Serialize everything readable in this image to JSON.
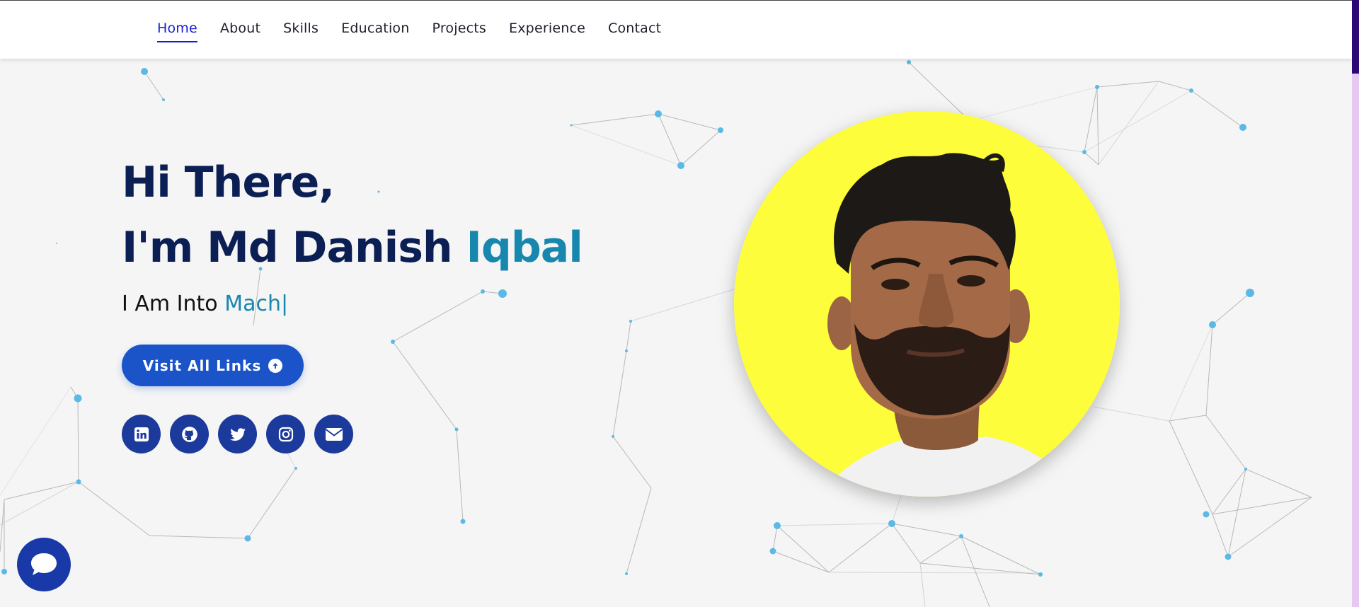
{
  "nav": {
    "items": [
      {
        "label": "Home",
        "active": true
      },
      {
        "label": "About"
      },
      {
        "label": "Skills"
      },
      {
        "label": "Education"
      },
      {
        "label": "Projects"
      },
      {
        "label": "Experience"
      },
      {
        "label": "Contact"
      }
    ]
  },
  "hero": {
    "greeting": "Hi There,",
    "intro_prefix": "I'm Md Danish",
    "intro_highlight": "Iqbal",
    "into_prefix": "I Am Into",
    "into_typed": "Mach",
    "cta_label": "Visit All Links",
    "cta_icon": "arrow-up-circle-icon"
  },
  "socials": [
    {
      "icon": "linkedin-icon"
    },
    {
      "icon": "github-icon"
    },
    {
      "icon": "twitter-icon"
    },
    {
      "icon": "instagram-icon"
    },
    {
      "icon": "envelope-icon"
    }
  ],
  "colors": {
    "accent": "#1787ad",
    "heading": "#0b1f55",
    "nav_active": "#1a1fd6",
    "button": "#1a54c8",
    "social_bg": "#1c3a9c",
    "photo_bg": "#fdfd3b",
    "particles": "#5bb9e6"
  },
  "chat_widget": {
    "icon": "chat-bubble-icon"
  }
}
